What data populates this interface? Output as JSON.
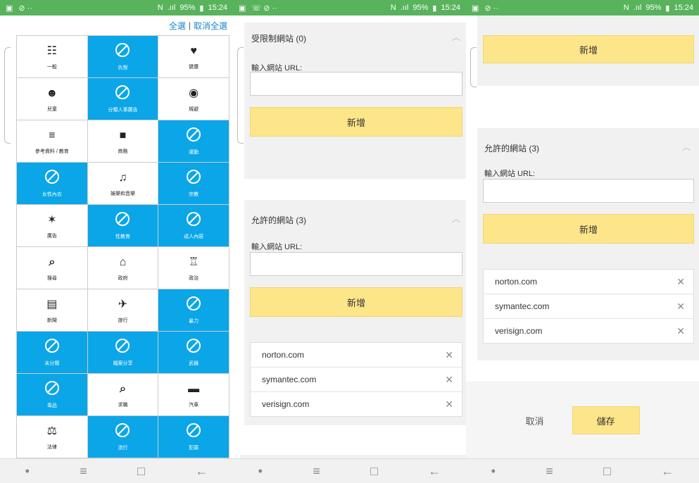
{
  "status_bar": {
    "battery": "95%",
    "time": "15:24",
    "net_text": "N",
    "signal_text": ".ııl"
  },
  "nav": {
    "recent": "≡",
    "home": "□",
    "back": "←",
    "dot": "•"
  },
  "selection": {
    "select_all": "全選",
    "separator": "|",
    "deselect_all": "取消全選"
  },
  "categories": [
    {
      "label": "一般",
      "blocked": false,
      "icon": "☷"
    },
    {
      "label": "仇恨",
      "blocked": true
    },
    {
      "label": "健康",
      "blocked": false,
      "icon": "♥"
    },
    {
      "label": "兒童",
      "blocked": false,
      "icon": "☻"
    },
    {
      "label": "分類人事廣告",
      "blocked": true
    },
    {
      "label": "規避",
      "blocked": false,
      "icon": "◉"
    },
    {
      "label": "參考資料 / 教育",
      "blocked": false,
      "icon": "≡"
    },
    {
      "label": "商務",
      "blocked": false,
      "icon": "■"
    },
    {
      "label": "運動",
      "blocked": true
    },
    {
      "label": "女性內衣",
      "blocked": true
    },
    {
      "label": "娛樂和音樂",
      "blocked": false,
      "icon": "♫"
    },
    {
      "label": "宗教",
      "blocked": true
    },
    {
      "label": "廣告",
      "blocked": false,
      "icon": "✶"
    },
    {
      "label": "性教育",
      "blocked": true
    },
    {
      "label": "成人內容",
      "blocked": true
    },
    {
      "label": "搜尋",
      "blocked": false,
      "icon": "⌕"
    },
    {
      "label": "政府",
      "blocked": false,
      "icon": "⌂"
    },
    {
      "label": "政治",
      "blocked": false,
      "icon": "♖"
    },
    {
      "label": "新聞",
      "blocked": false,
      "icon": "▤"
    },
    {
      "label": "旅行",
      "blocked": false,
      "icon": "✈"
    },
    {
      "label": "暴力",
      "blocked": true
    },
    {
      "label": "未分類",
      "blocked": true
    },
    {
      "label": "檔案分享",
      "blocked": true
    },
    {
      "label": "武器",
      "blocked": true
    },
    {
      "label": "毒品",
      "blocked": true
    },
    {
      "label": "求職",
      "blocked": false,
      "icon": "⌕"
    },
    {
      "label": "汽車",
      "blocked": false,
      "icon": "▬"
    },
    {
      "label": "法律",
      "blocked": false,
      "icon": "⚖"
    },
    {
      "label": "流行",
      "blocked": true
    },
    {
      "label": "犯罪",
      "blocked": true
    }
  ],
  "restricted": {
    "title": "受限制網站 (0)",
    "url_label": "輸入網站 URL:",
    "url_value": "",
    "add_label": "新增"
  },
  "allowed": {
    "title": "允許的網站 (3)",
    "url_label": "輸入網站 URL:",
    "url_value": "",
    "add_label": "新增",
    "sites": [
      "norton.com",
      "symantec.com",
      "verisign.com"
    ]
  },
  "footer": {
    "cancel_label": "取消",
    "save_label": "儲存"
  },
  "colors": {
    "status_green": "#58b35c",
    "blocked_blue": "#0ba6e8",
    "button_yellow": "#fde58a",
    "link_blue": "#1a86c9"
  }
}
